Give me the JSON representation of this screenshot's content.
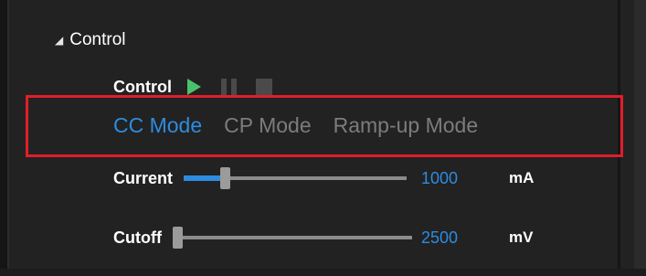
{
  "section": {
    "title": "Control"
  },
  "control": {
    "label": "Control"
  },
  "icons": {
    "play": "play-icon",
    "pause": "pause-icon",
    "stop": "stop-icon",
    "expand": "expanded-triangle-icon"
  },
  "modes": [
    {
      "label": "CC Mode",
      "active": true
    },
    {
      "label": "CP Mode",
      "active": false
    },
    {
      "label": "Ramp-up Mode",
      "active": false
    }
  ],
  "sliders": {
    "current": {
      "label": "Current",
      "value": "1000",
      "unit": "mA",
      "level": 0.17
    },
    "cutoff": {
      "label": "Cutoff",
      "value": "2500",
      "unit": "mV",
      "level": 0.0
    }
  },
  "colors": {
    "accent": "#2d8ce0",
    "highlight_box": "#e11e2a",
    "play": "#4cc16b",
    "disabled": "#4a4a4a",
    "inactive_text": "#7c7c7c",
    "background": "#222222"
  }
}
